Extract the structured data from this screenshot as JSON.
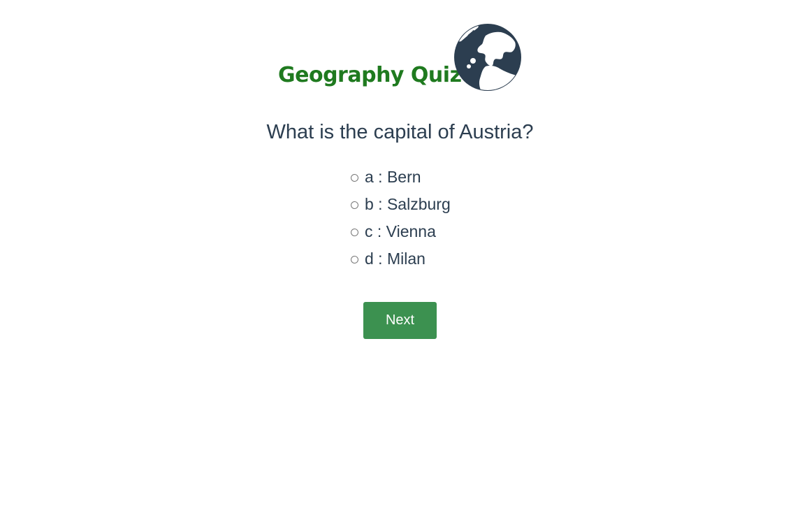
{
  "header": {
    "title": "Geography Quiz",
    "logo_icon": "globe-icon",
    "title_color": "#1f7a1f",
    "globe_color": "#2c3e50"
  },
  "quiz": {
    "question": "What is the capital of Austria?",
    "options": [
      {
        "label": "a : Bern"
      },
      {
        "label": "b : Salzburg"
      },
      {
        "label": "c : Vienna"
      },
      {
        "label": "d : Milan"
      }
    ],
    "selected": null,
    "next_label": "Next",
    "button_color": "#3c9150"
  }
}
